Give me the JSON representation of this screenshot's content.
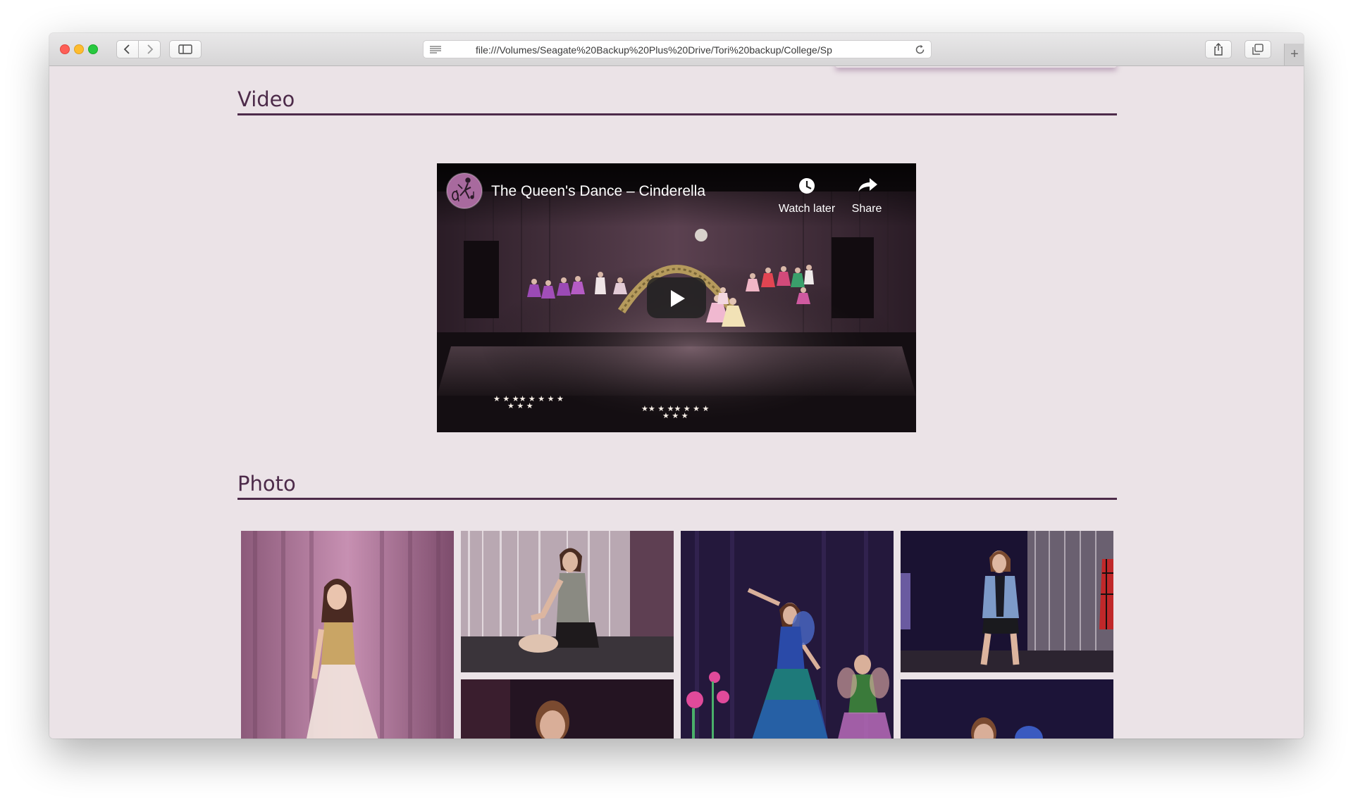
{
  "browser": {
    "url": "file:///Volumes/Seagate%20Backup%20Plus%20Drive/Tori%20backup/College/Sp",
    "icons": {
      "back": "chevron-left-icon",
      "forward": "chevron-right-icon",
      "sidebar": "sidebar-icon",
      "reader": "reader-icon",
      "reload": "reload-icon",
      "share": "share-icon",
      "tabs": "tabs-icon",
      "new_tab": "plus-icon"
    },
    "traffic_colors": [
      "#fe5f57",
      "#febc2e",
      "#28c840"
    ]
  },
  "sections": {
    "video": {
      "title": "Video"
    },
    "photo": {
      "title": "Photo"
    }
  },
  "video_player": {
    "title": "The Queen's Dance – Cinderella",
    "watch_later_label": "Watch later",
    "share_label": "Share",
    "channel_icon": "ballet-dancer-icon",
    "play_icon": "play-icon"
  },
  "photos": [
    {
      "subject": "dancer-in-white-gown"
    },
    {
      "subject": "dancer-seated-on-stage"
    },
    {
      "subject": "dancer-in-blue-fairy-dress"
    },
    {
      "subject": "dancer-in-plaid-shirt"
    },
    {
      "subject": "dancer-portrait"
    },
    {
      "subject": "dancer-with-blue-prop"
    }
  ],
  "colors": {
    "page_background": "#ebe3e7",
    "accent": "#4d2b4a"
  }
}
